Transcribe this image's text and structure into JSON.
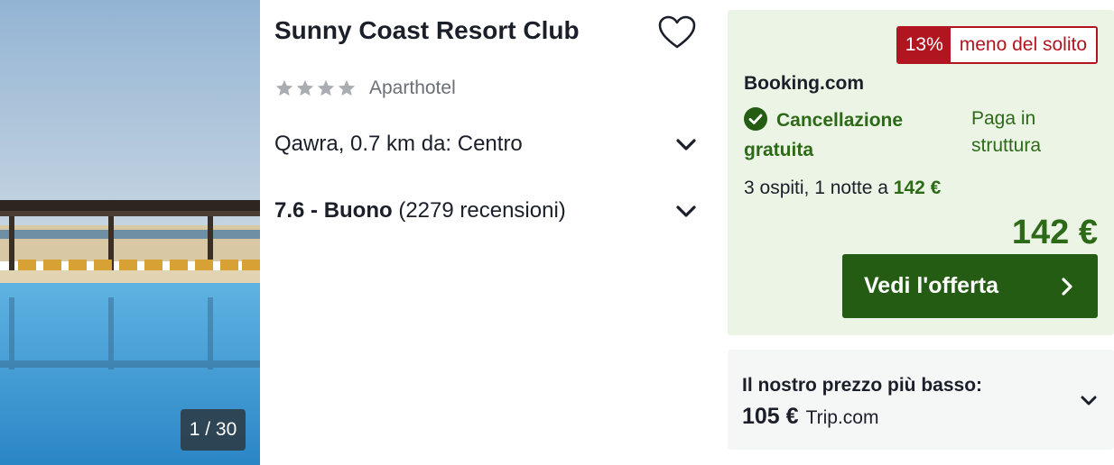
{
  "photo": {
    "counter": "1 / 30"
  },
  "hotel": {
    "name": "Sunny Coast Resort Club",
    "stars": 4,
    "type": "Aparthotel",
    "location": "Qawra, 0.7 km da: Centro",
    "score": "7.6 - Buono",
    "reviews": "(2279 recensioni)"
  },
  "offer": {
    "discount_pct": "13%",
    "discount_text": "meno del solito",
    "provider": "Booking.com",
    "free_cancel": "Cancellazione gratuita",
    "pay_at_property": "Paga in struttura",
    "guests_text": "3 ospiti, 1 notte a",
    "guests_price": "142 €",
    "price": "142 €",
    "cta_label": "Vedi l'offerta"
  },
  "lowest": {
    "label": "Il nostro prezzo più basso:",
    "price": "105 €",
    "provider": "Trip.com"
  },
  "colors": {
    "green_dark": "#235c12",
    "green_text": "#2d6a17",
    "green_bg": "#ecf4e6",
    "red": "#b1151f",
    "star_gray": "#a9adb2"
  },
  "icons": [
    "heart-icon",
    "star-icon",
    "chevron-down-icon",
    "check-circle-icon",
    "chevron-right-icon"
  ]
}
